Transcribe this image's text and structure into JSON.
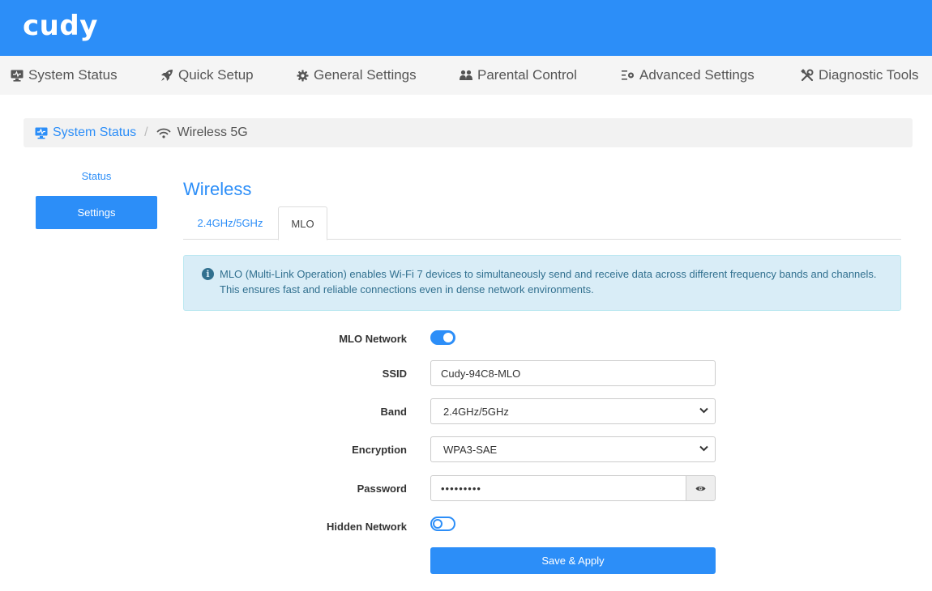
{
  "brand": {
    "logo_text": "cudy",
    "color": "#2c8ef8"
  },
  "nav": {
    "items": [
      {
        "label": "System Status",
        "icon": "monitor-icon"
      },
      {
        "label": "Quick Setup",
        "icon": "rocket-icon"
      },
      {
        "label": "General Settings",
        "icon": "gear-icon"
      },
      {
        "label": "Parental Control",
        "icon": "users-icon"
      },
      {
        "label": "Advanced Settings",
        "icon": "sliders-gear-icon"
      },
      {
        "label": "Diagnostic Tools",
        "icon": "tools-icon"
      }
    ]
  },
  "breadcrumb": {
    "home": "System Status",
    "current": "Wireless 5G"
  },
  "sidebar": {
    "status": "Status",
    "settings": "Settings"
  },
  "main": {
    "title": "Wireless",
    "tabs": [
      {
        "label": "2.4GHz/5GHz",
        "active": false
      },
      {
        "label": "MLO",
        "active": true
      }
    ],
    "info": "MLO (Multi-Link Operation) enables Wi-Fi 7 devices to simultaneously send and receive data across different frequency bands and channels. This ensures fast and reliable connections even in dense network environments."
  },
  "form": {
    "mlo_network": {
      "label": "MLO Network",
      "enabled": true
    },
    "ssid": {
      "label": "SSID",
      "value": "Cudy-94C8-MLO"
    },
    "band": {
      "label": "Band",
      "value": "2.4GHz/5GHz"
    },
    "encryption": {
      "label": "Encryption",
      "value": "WPA3-SAE"
    },
    "password": {
      "label": "Password",
      "masked_value": "••••••••• "
    },
    "hidden_network": {
      "label": "Hidden Network",
      "enabled": false
    },
    "save_label": "Save & Apply"
  }
}
